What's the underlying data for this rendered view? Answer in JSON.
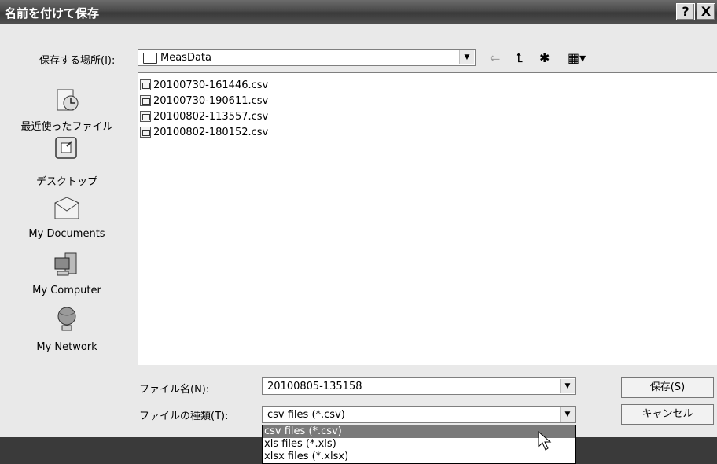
{
  "window": {
    "title": "名前を付けて保存",
    "help_button": "?",
    "close_button": "X"
  },
  "location": {
    "label": "保存する場所(I):",
    "value": "MeasData"
  },
  "places": [
    {
      "label": "最近使ったファイル"
    },
    {
      "label": "デスクトップ"
    },
    {
      "label": "My Documents"
    },
    {
      "label": "My Computer"
    },
    {
      "label": "My Network"
    }
  ],
  "files": [
    {
      "name": "20100730-161446.csv"
    },
    {
      "name": "20100730-190611.csv"
    },
    {
      "name": "20100802-113557.csv"
    },
    {
      "name": "20100802-180152.csv"
    }
  ],
  "filename": {
    "label": "ファイル名(N):",
    "value": "20100805-135158"
  },
  "filetype": {
    "label": "ファイルの種類(T):",
    "value": "csv files (*.csv)",
    "options": [
      "csv files (*.csv)",
      "xls files (*.xls)",
      "xlsx files (*.xlsx)"
    ]
  },
  "buttons": {
    "save": "保存(S)",
    "cancel": "キャンセル"
  }
}
